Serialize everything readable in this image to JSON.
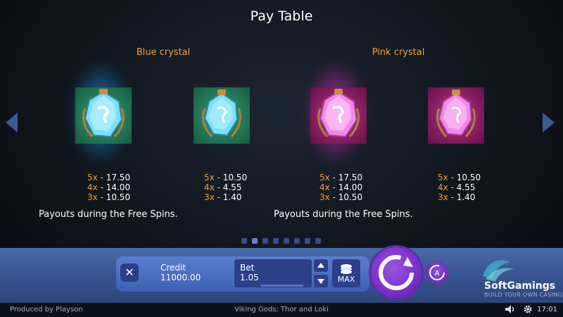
{
  "title": "Pay Table",
  "groups": [
    {
      "name": "Blue crystal",
      "note": "Payouts during the Free Spins."
    },
    {
      "name": "Pink crystal",
      "note": "Payouts during the Free Spins."
    }
  ],
  "symbols": [
    {
      "icon": "blue-crystal-glowing-icon",
      "payouts": [
        {
          "mult": "5x",
          "amount": "17.50"
        },
        {
          "mult": "4x",
          "amount": "14.00"
        },
        {
          "mult": "3x",
          "amount": "10.50"
        }
      ]
    },
    {
      "icon": "blue-crystal-icon",
      "payouts": [
        {
          "mult": "5x",
          "amount": "10.50"
        },
        {
          "mult": "4x",
          "amount": "4.55"
        },
        {
          "mult": "3x",
          "amount": "1.40"
        }
      ]
    },
    {
      "icon": "pink-crystal-glowing-icon",
      "payouts": [
        {
          "mult": "5x",
          "amount": "17.50"
        },
        {
          "mult": "4x",
          "amount": "14.00"
        },
        {
          "mult": "3x",
          "amount": "10.50"
        }
      ]
    },
    {
      "icon": "pink-crystal-icon",
      "payouts": [
        {
          "mult": "5x",
          "amount": "10.50"
        },
        {
          "mult": "4x",
          "amount": "4.55"
        },
        {
          "mult": "3x",
          "amount": "1.40"
        }
      ]
    }
  ],
  "pagination": {
    "total": 8,
    "active_index": 1
  },
  "controls": {
    "credit_label": "Credit",
    "credit_value": "11000.00",
    "bet_label": "Bet",
    "bet_value": "1.05",
    "max_label": "MAX",
    "close_symbol": "✕"
  },
  "brand": {
    "name": "SoftGamings",
    "tagline": "BUILD YOUR OWN CASINO"
  },
  "footer": {
    "produced_by": "Produced by Playson",
    "game_name": "Viking Gods: Thor and Loki",
    "time": "17:01"
  },
  "colors": {
    "accent_orange": "#f0a040",
    "panel_blue": "#3e5fb0",
    "spin_purple": "#7a2fc8"
  }
}
